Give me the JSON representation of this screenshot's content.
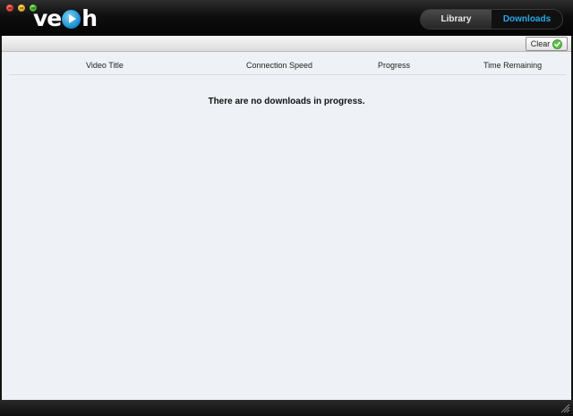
{
  "app": {
    "logo_text_left": "ve",
    "logo_text_right": "h"
  },
  "nav": {
    "library_label": "Library",
    "downloads_label": "Downloads",
    "active_tab": "Downloads",
    "active_color": "#27a9e8"
  },
  "toolbar": {
    "clear_label": "Clear",
    "clear_icon": "check-icon"
  },
  "table": {
    "columns": [
      "Video Title",
      "Connection Speed",
      "Progress",
      "Time Remaining"
    ],
    "rows": []
  },
  "status": {
    "empty_message": "There are no downloads in progress."
  }
}
